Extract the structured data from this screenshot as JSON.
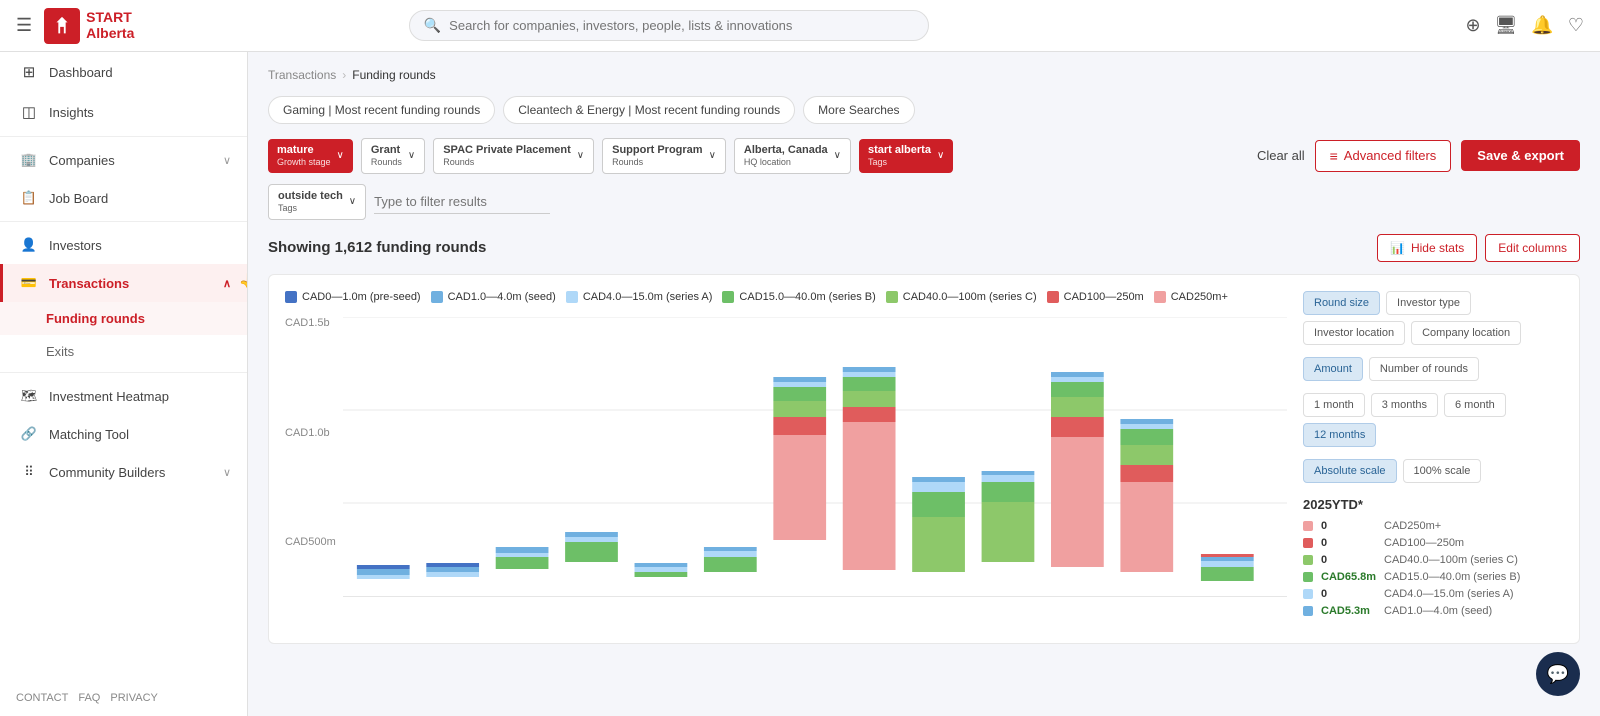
{
  "app": {
    "title": "START Alberta",
    "search_placeholder": "Search for companies, investors, people, lists & innovations"
  },
  "sidebar": {
    "items": [
      {
        "id": "dashboard",
        "label": "Dashboard",
        "icon": "⊞",
        "active": false
      },
      {
        "id": "insights",
        "label": "Insights",
        "icon": "◫",
        "active": false
      },
      {
        "id": "companies",
        "label": "Companies",
        "icon": "🏢",
        "active": false,
        "has_chevron": true
      },
      {
        "id": "job-board",
        "label": "Job Board",
        "icon": "📋",
        "active": false
      },
      {
        "id": "investors",
        "label": "Investors",
        "icon": "👤",
        "active": false
      },
      {
        "id": "transactions",
        "label": "Transactions",
        "icon": "💳",
        "active": true,
        "has_chevron": true
      },
      {
        "id": "investment-heatmap",
        "label": "Investment Heatmap",
        "icon": "🗺",
        "active": false
      },
      {
        "id": "matching-tool",
        "label": "Matching Tool",
        "icon": "🔗",
        "active": false
      },
      {
        "id": "community-builders",
        "label": "Community Builders",
        "icon": "⠿",
        "active": false,
        "has_chevron": true
      }
    ],
    "sub_items": [
      {
        "id": "funding-rounds",
        "label": "Funding rounds",
        "active": true
      },
      {
        "id": "exits",
        "label": "Exits",
        "active": false
      }
    ],
    "footer_links": [
      "CONTACT",
      "FAQ",
      "PRIVACY"
    ]
  },
  "breadcrumb": {
    "parent": "Transactions",
    "current": "Funding rounds"
  },
  "saved_searches": [
    {
      "id": "gaming",
      "label": "Gaming | Most recent funding rounds"
    },
    {
      "id": "cleantech",
      "label": "Cleantech & Energy | Most recent funding rounds"
    },
    {
      "id": "more",
      "label": "More Searches"
    }
  ],
  "filters": [
    {
      "id": "growth-stage",
      "type": "Growth stage",
      "value": "mature",
      "style": "red"
    },
    {
      "id": "rounds-grant",
      "type": "Rounds",
      "value": "Grant",
      "style": "outline"
    },
    {
      "id": "rounds-spac",
      "type": "Rounds",
      "value": "SPAC Private Placement",
      "style": "outline"
    },
    {
      "id": "rounds-support",
      "type": "Rounds",
      "value": "Support Program",
      "style": "outline"
    },
    {
      "id": "hq-location",
      "type": "HQ location",
      "value": "Alberta, Canada",
      "style": "outline"
    },
    {
      "id": "tags-start",
      "type": "Tags",
      "value": "start alberta",
      "style": "red"
    },
    {
      "id": "tags-outside",
      "type": "Tags",
      "value": "outside tech",
      "style": "outline"
    }
  ],
  "filter_input_placeholder": "Type to filter results",
  "actions": {
    "clear_all": "Clear all",
    "advanced_filters": "Advanced filters",
    "save_export": "Save & export"
  },
  "results": {
    "count_label": "Showing 1,612 funding rounds",
    "hide_stats": "Hide stats",
    "edit_columns": "Edit columns"
  },
  "legend": [
    {
      "id": "pre-seed",
      "label": "CAD0—1.0m (pre-seed)",
      "color": "#4472c4"
    },
    {
      "id": "seed",
      "label": "CAD1.0—4.0m (seed)",
      "color": "#70b0e0"
    },
    {
      "id": "series-a",
      "label": "CAD4.0—15.0m (series A)",
      "color": "#afd8f8"
    },
    {
      "id": "series-b",
      "label": "CAD15.0—40.0m (series B)",
      "color": "#6dbf67"
    },
    {
      "id": "series-c",
      "label": "CAD40.0—100m (series C)",
      "color": "#8dc86a"
    },
    {
      "id": "cad100-250",
      "label": "CAD100—250m",
      "color": "#e05c5c"
    },
    {
      "id": "cad250plus",
      "label": "CAD250m+",
      "color": "#f0a0a0"
    }
  ],
  "chart_y_labels": [
    "CAD1.5b",
    "",
    "CAD1.0b",
    "",
    "CAD500m",
    ""
  ],
  "chart_controls": {
    "group1": [
      {
        "id": "round-size",
        "label": "Round size",
        "active": true
      },
      {
        "id": "investor-type",
        "label": "Investor type",
        "active": false
      },
      {
        "id": "investor-location",
        "label": "Investor location",
        "active": false
      },
      {
        "id": "company-location",
        "label": "Company location",
        "active": false
      }
    ],
    "group2": [
      {
        "id": "amount",
        "label": "Amount",
        "active": true
      },
      {
        "id": "number-of-rounds",
        "label": "Number of rounds",
        "active": false
      }
    ],
    "group3": [
      {
        "id": "1month",
        "label": "1 month",
        "active": false
      },
      {
        "id": "3months",
        "label": "3 months",
        "active": false
      },
      {
        "id": "6month",
        "label": "6 month",
        "active": false
      },
      {
        "id": "12months",
        "label": "12 months",
        "active": true
      }
    ],
    "group4": [
      {
        "id": "absolute-scale",
        "label": "Absolute scale",
        "active": true
      },
      {
        "id": "100-scale",
        "label": "100% scale",
        "active": false
      }
    ]
  },
  "ytd": {
    "title": "2025YTD*",
    "items": [
      {
        "color": "#f0a0a0",
        "value": "0",
        "label": "CAD250m+"
      },
      {
        "color": "#e05c5c",
        "value": "0",
        "label": "CAD100—250m"
      },
      {
        "color": "#8dc86a",
        "value": "0",
        "label": "CAD40.0—100m (series C)"
      },
      {
        "color": "#6dbf67",
        "value": "CAD65.8m",
        "label": "CAD15.0—40.0m (series B)"
      },
      {
        "color": "#afd8f8",
        "value": "0",
        "label": "CAD4.0—15.0m (series A)"
      },
      {
        "color": "#70b0e0",
        "value": "CAD5.3m",
        "label": "CAD1.0—4.0m (seed)"
      }
    ]
  }
}
